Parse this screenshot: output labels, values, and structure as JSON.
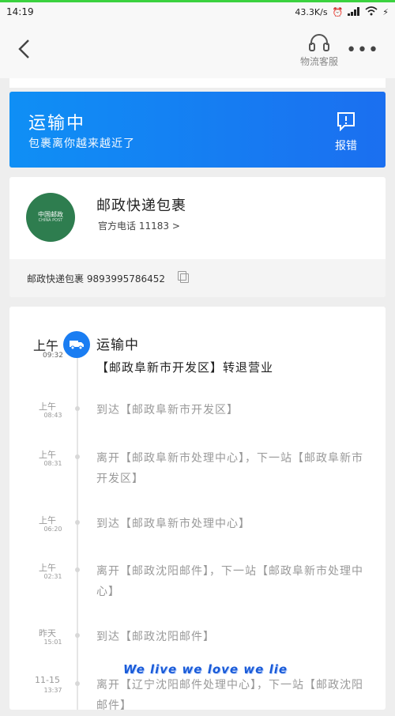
{
  "status_bar": {
    "time": "14:19",
    "network_speed": "43.3K/s",
    "signal": "4G"
  },
  "nav": {
    "service_label": "物流客服"
  },
  "status_card": {
    "title": "运输中",
    "subtitle": "包裹离你越来越近了",
    "report_label": "报错",
    "accent": "#1a7df2"
  },
  "package": {
    "carrier": "邮政快递包裹",
    "logo_cn": "中国邮政",
    "logo_en": "CHINA POST",
    "phone_label": "官方电话 11183",
    "tracking_label": "邮政快递包裹 9893995786452"
  },
  "timeline": {
    "current": {
      "day": "上午",
      "time": "09:32",
      "title": "运输中",
      "detail": "【邮政阜新市开发区】转退营业"
    },
    "events": [
      {
        "day": "上午",
        "time": "08:43",
        "text": "到达【邮政阜新市开发区】"
      },
      {
        "day": "上午",
        "time": "08:31",
        "text": "离开【邮政阜新市处理中心】，下一站【邮政阜新市开发区】"
      },
      {
        "day": "上午",
        "time": "06:20",
        "text": "到达【邮政阜新市处理中心】"
      },
      {
        "day": "上午",
        "time": "02:31",
        "text": "离开【邮政沈阳邮件】，下一站【邮政阜新市处理中心】"
      },
      {
        "day": "昨天",
        "time": "15:01",
        "text": "到达【邮政沈阳邮件】"
      },
      {
        "day": "11-15",
        "time": "13:37",
        "text": "离开【辽宁沈阳邮件处理中心】，下一站【邮政沈阳邮件】"
      }
    ]
  },
  "watermark": "We live we love we lie"
}
